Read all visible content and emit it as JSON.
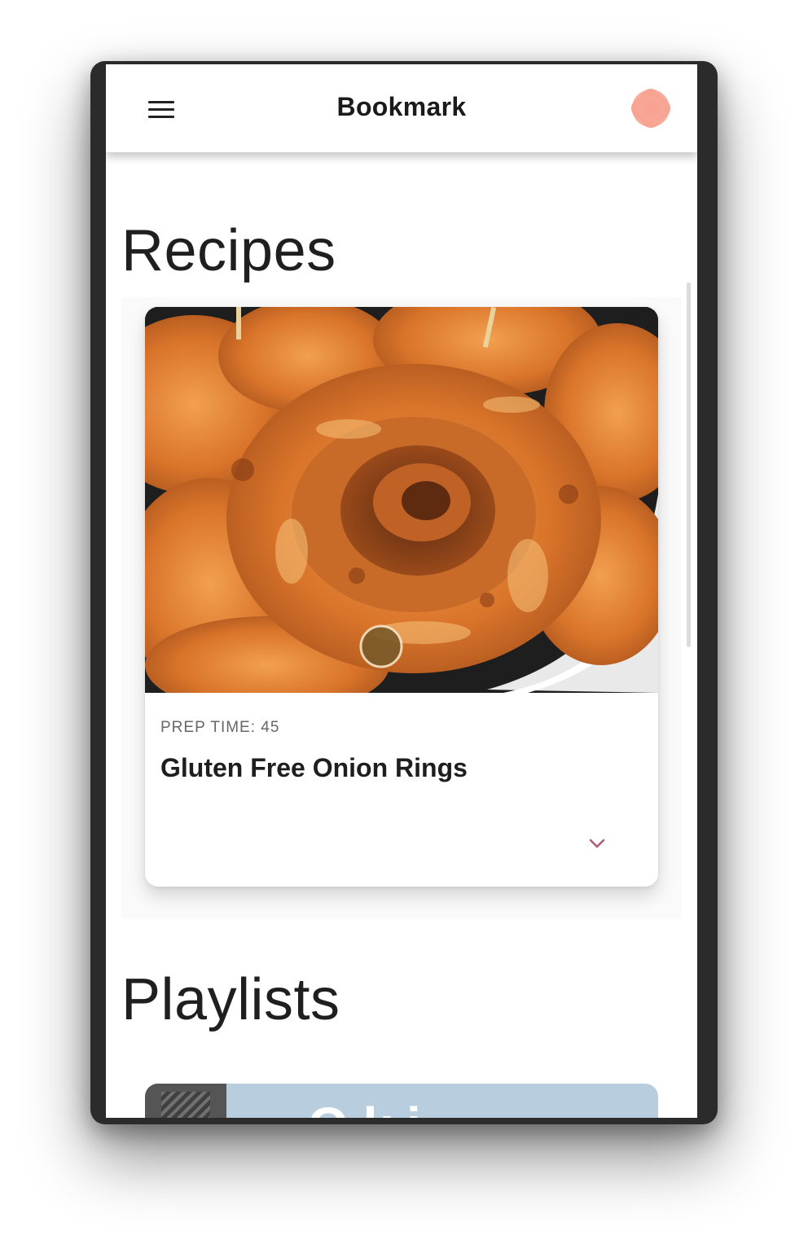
{
  "app_bar": {
    "title": "Bookmark",
    "menu_icon": "hamburger-menu-icon",
    "avatar_icon": "flower-avatar-icon"
  },
  "sections": {
    "recipes": {
      "heading": "Recipes",
      "card": {
        "prep_time": "PREP TIME: 45",
        "name": "Gluten Free Onion Rings",
        "image": "onion-rings-photo",
        "expand_icon": "chevron-down-icon"
      }
    },
    "playlists": {
      "heading": "Playlists",
      "card_peek_text": "O k i"
    }
  },
  "colors": {
    "accent": "#b05a78",
    "avatar": "#f7a595",
    "playlist_card_bg": "#b8cede"
  }
}
